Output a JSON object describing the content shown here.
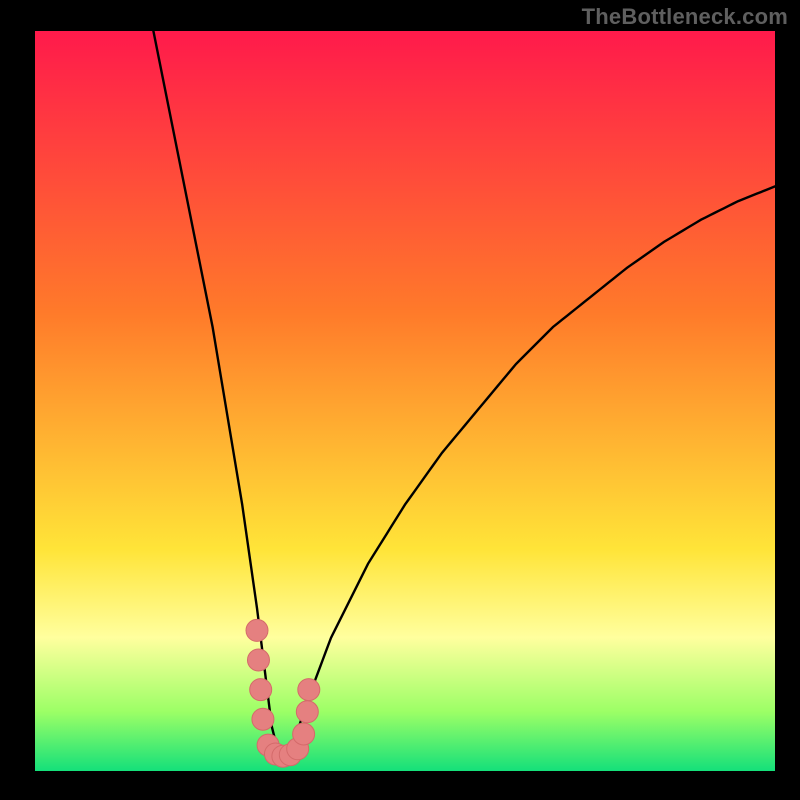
{
  "attribution": "TheBottleneck.com",
  "colors": {
    "bg_black": "#000000",
    "grad_top": "#ff1a4b",
    "grad_mid1": "#ff7a2a",
    "grad_mid2": "#ffe438",
    "grad_band": "#ffff9e",
    "grad_green1": "#9cff66",
    "grad_green2": "#14e07a",
    "curve": "#000000",
    "marker_fill": "#e58080",
    "marker_stroke": "#d46a6a"
  },
  "chart_data": {
    "type": "line",
    "title": "",
    "xlabel": "",
    "ylabel": "",
    "xlim": [
      0,
      100
    ],
    "ylim": [
      0,
      100
    ],
    "note": "V-shaped bottleneck curve; minimum near x≈33; axes are unlabeled. x/y in percent of plot box.",
    "series": [
      {
        "name": "bottleneck-curve",
        "x": [
          16,
          18,
          20,
          22,
          24,
          26,
          28,
          30,
          31,
          32,
          33,
          34,
          35,
          37,
          40,
          45,
          50,
          55,
          60,
          65,
          70,
          75,
          80,
          85,
          90,
          95,
          100
        ],
        "y": [
          100,
          90,
          80,
          70,
          60,
          48,
          36,
          22,
          14,
          6,
          2,
          2,
          4,
          10,
          18,
          28,
          36,
          43,
          49,
          55,
          60,
          64,
          68,
          71.5,
          74.5,
          77,
          79
        ]
      }
    ],
    "markers": {
      "name": "highlighted-segment",
      "x": [
        30.0,
        30.2,
        30.5,
        30.8,
        31.5,
        32.5,
        33.5,
        34.5,
        35.5,
        36.3,
        36.8,
        37.0
      ],
      "y": [
        19,
        15,
        11,
        7,
        3.5,
        2.3,
        2.0,
        2.2,
        3.0,
        5.0,
        8.0,
        11.0
      ]
    }
  }
}
